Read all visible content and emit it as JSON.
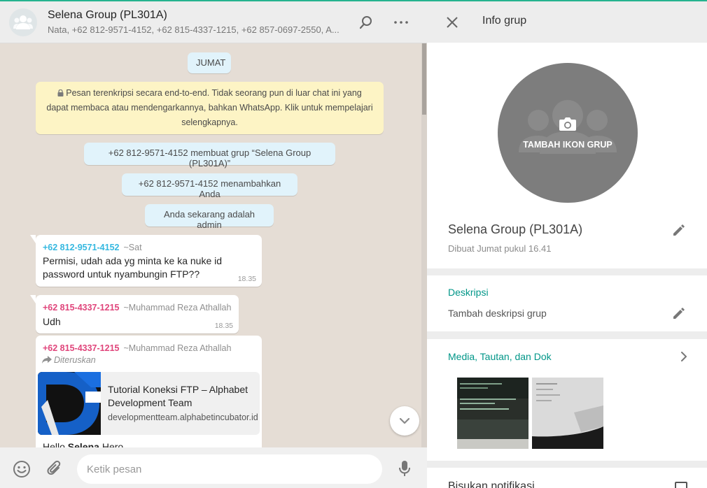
{
  "chat": {
    "title": "Selena Group (PL301A)",
    "members": "Nata, +62 812-9571-4152, +62 815-4337-1215, +62 857-0697-2550, A...",
    "day_label": "JUMAT",
    "encryption_notice": "Pesan terenkripsi secara end-to-end. Tidak seorang pun di luar chat ini yang dapat membaca atau mendengarkannya, bahkan WhatsApp. Klik untuk mempelajari selengkapnya.",
    "system_messages": [
      "+62 812-9571-4152 membuat grup “Selena Group (PL301A)”",
      "+62 812-9571-4152 menambahkan Anda",
      "Anda sekarang adalah admin"
    ],
    "messages": [
      {
        "sender": "+62 812-9571-4152",
        "nick": "~Sat",
        "sender_color": "#35b8e0",
        "text": "Permisi, udah ada yg minta ke ka nuke id password untuk nyambungin FTP??",
        "time": "18.35"
      },
      {
        "sender": "+62 815-4337-1215",
        "nick": "~Muhammad Reza Athallah",
        "sender_color": "#e0457b",
        "text": "Udh",
        "time": "18.35"
      },
      {
        "sender": "+62 815-4337-1215",
        "nick": "~Muhammad Reza Athallah",
        "sender_color": "#e0457b",
        "forwarded": "Diteruskan",
        "link_title": "Tutorial Koneksi FTP – Alphabet Development Team",
        "link_domain": "developmentteam.alphabetincubator.id",
        "text_prefix": "Hello ",
        "text_bold": "Selena",
        "text_suffix": " Hero"
      }
    ],
    "composer_placeholder": "Ketik pesan"
  },
  "info": {
    "title": "Info grup",
    "avatar_label": "TAMBAH IKON GRUP",
    "group_name": "Selena Group (PL301A)",
    "created": "Dibuat Jumat pukul 16.41",
    "description_title": "Deskripsi",
    "description_placeholder": "Tambah deskripsi grup",
    "media_title": "Media, Tautan, dan Dok",
    "mute_label": "Bisukan notifikasi"
  },
  "colors": {
    "accent": "#25b38f",
    "section_title": "#009688",
    "encrypt_bg": "#fdf4c5",
    "system_bg": "#e1f3fb"
  },
  "icons": {
    "header": [
      "search-icon",
      "menu-dots-icon"
    ],
    "composer": [
      "emoji-icon",
      "attach-icon",
      "mic-icon"
    ],
    "info": [
      "close-icon",
      "camera-icon",
      "pencil-icon",
      "chevron-right-icon"
    ]
  }
}
